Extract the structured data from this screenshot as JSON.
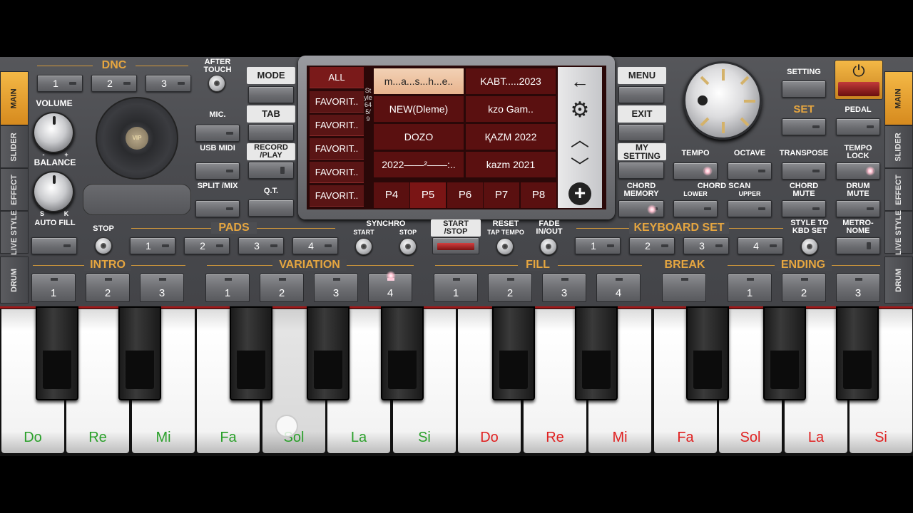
{
  "sidebar_left": [
    "MAIN",
    "SLIDER",
    "EFFECT",
    "LIVE STYLE",
    "DRUM"
  ],
  "sidebar_right": [
    "MAIN",
    "SLIDER",
    "EFFECT",
    "LIVE STYLE",
    "DRUM"
  ],
  "dnc": {
    "title": "DNC",
    "buttons": [
      "1",
      "2",
      "3"
    ],
    "after_touch": "AFTER TOUCH"
  },
  "volume": "VOLUME",
  "balance": "BALANCE",
  "balance_s": "S",
  "balance_k": "K",
  "vol_minus": "-",
  "vol_plus": "+",
  "vip": "VIP",
  "mic": "MIC.",
  "usb_midi": "USB MIDI",
  "split_mix": "SPLIT /MIX",
  "mode": "MODE",
  "tab": "TAB",
  "record_play": "RECORD /PLAY",
  "qt": "Q.T.",
  "screen": {
    "categories": [
      "ALL",
      "FAVORIT..",
      "FAVORIT..",
      "FAVORIT..",
      "FAVORIT..",
      "FAVORIT.."
    ],
    "side_label": "Style 64  5/9",
    "styles": [
      "m...a...s...h...e..",
      "KABT.....2023",
      "NEW(Dleme)",
      "kzo Gam..",
      "DOZO",
      "ҚAZM 2022",
      "2022——²——:..",
      "kazm 2021"
    ],
    "pages": [
      "P4",
      "P5",
      "P6",
      "P7",
      "P8"
    ],
    "nav": {
      "back": "←",
      "settings": "⚙",
      "up": "︿",
      "down": "﹀",
      "add": "+"
    }
  },
  "menu": "MENU",
  "exit": "EXIT",
  "my_setting": "MY SETTING",
  "chord_memory": "CHORD MEMORY",
  "setting": "SETTING",
  "set": "SET",
  "pedal": "PEDAL",
  "power": "⏻",
  "tempo": "TEMPO",
  "octave": "OCTAVE",
  "transpose": "TRANSPOSE",
  "tempo_lock": "TEMPO LOCK",
  "chord_scan": "CHORD SCAN",
  "lower": "LOWER",
  "upper": "UPPER",
  "chord_mute": "CHORD MUTE",
  "drum_mute": "DRUM MUTE",
  "auto_fill": "AUTO FILL",
  "stop": "STOP",
  "pads": {
    "title": "PADS",
    "buttons": [
      "1",
      "2",
      "3",
      "4"
    ]
  },
  "synchro": "SYNCHRO",
  "synchro_start": "START",
  "synchro_stop": "STOP",
  "start_stop": "START /STOP",
  "reset": "RESET",
  "tap_tempo": "TAP TEMPO",
  "fade": "FADE IN/OUT",
  "keyboard_set": {
    "title": "KEYBOARD SET",
    "buttons": [
      "1",
      "2",
      "3",
      "4"
    ]
  },
  "style_to_kbd": "STYLE TO KBD SET",
  "metronome": "METRO- NOME",
  "intro": {
    "title": "INTRO",
    "buttons": [
      "1",
      "2",
      "3"
    ]
  },
  "variation": {
    "title": "VARIATION",
    "buttons": [
      "1",
      "2",
      "3",
      "4"
    ]
  },
  "fill": {
    "title": "FILL",
    "buttons": [
      "1",
      "2",
      "3",
      "4"
    ]
  },
  "break": {
    "title": "BREAK"
  },
  "ending": {
    "title": "ENDING",
    "buttons": [
      "1",
      "2",
      "3"
    ]
  },
  "keys": [
    "Do",
    "Re",
    "Mi",
    "Fa",
    "Sol",
    "La",
    "Si",
    "Do",
    "Re",
    "Mi",
    "Fa",
    "Sol",
    "La",
    "Si"
  ],
  "colors": {
    "gold": "#e6a640",
    "green_note": "#2aa02a",
    "red_note": "#e02020",
    "screen_red": "#5a1010"
  }
}
